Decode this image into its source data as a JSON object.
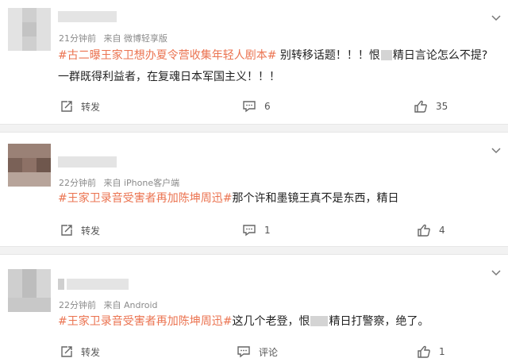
{
  "posts": [
    {
      "time": "21分钟前",
      "source": "来自 微博轻享版",
      "tag": "#古二曝王家卫想办夏令营收集年轻人剧本#",
      "text_a": " 别转移话题！！！恨",
      "text_b": "精日言论怎么不提?",
      "line2": "一群既得利益者，在复魂日本军国主义！！！",
      "repost_label": "转发",
      "comment_count": "6",
      "like_count": "35"
    },
    {
      "time": "22分钟前",
      "source": "来自 iPhone客户端",
      "tag": "#王家卫录音受害者再加陈坤周迅#",
      "text_a": "那个许和墨镜王真不是东西，精日",
      "repost_label": "转发",
      "comment_count": "1",
      "like_count": "4"
    },
    {
      "time": "22分钟前",
      "source": "来自 Android",
      "tag": "#王家卫录音受害者再加陈坤周迅#",
      "text_a": "这几个老登，恨",
      "text_b": "精日打警察，绝了。",
      "repost_label": "转发",
      "comment_label": "评论",
      "like_count": "1"
    }
  ],
  "colors": {
    "topic": "#eb7350",
    "meta": "#8a8a8a",
    "separator": "#f2f2f2"
  },
  "icons": [
    "repost-icon",
    "comment-icon",
    "like-icon",
    "chevron-down-icon"
  ]
}
